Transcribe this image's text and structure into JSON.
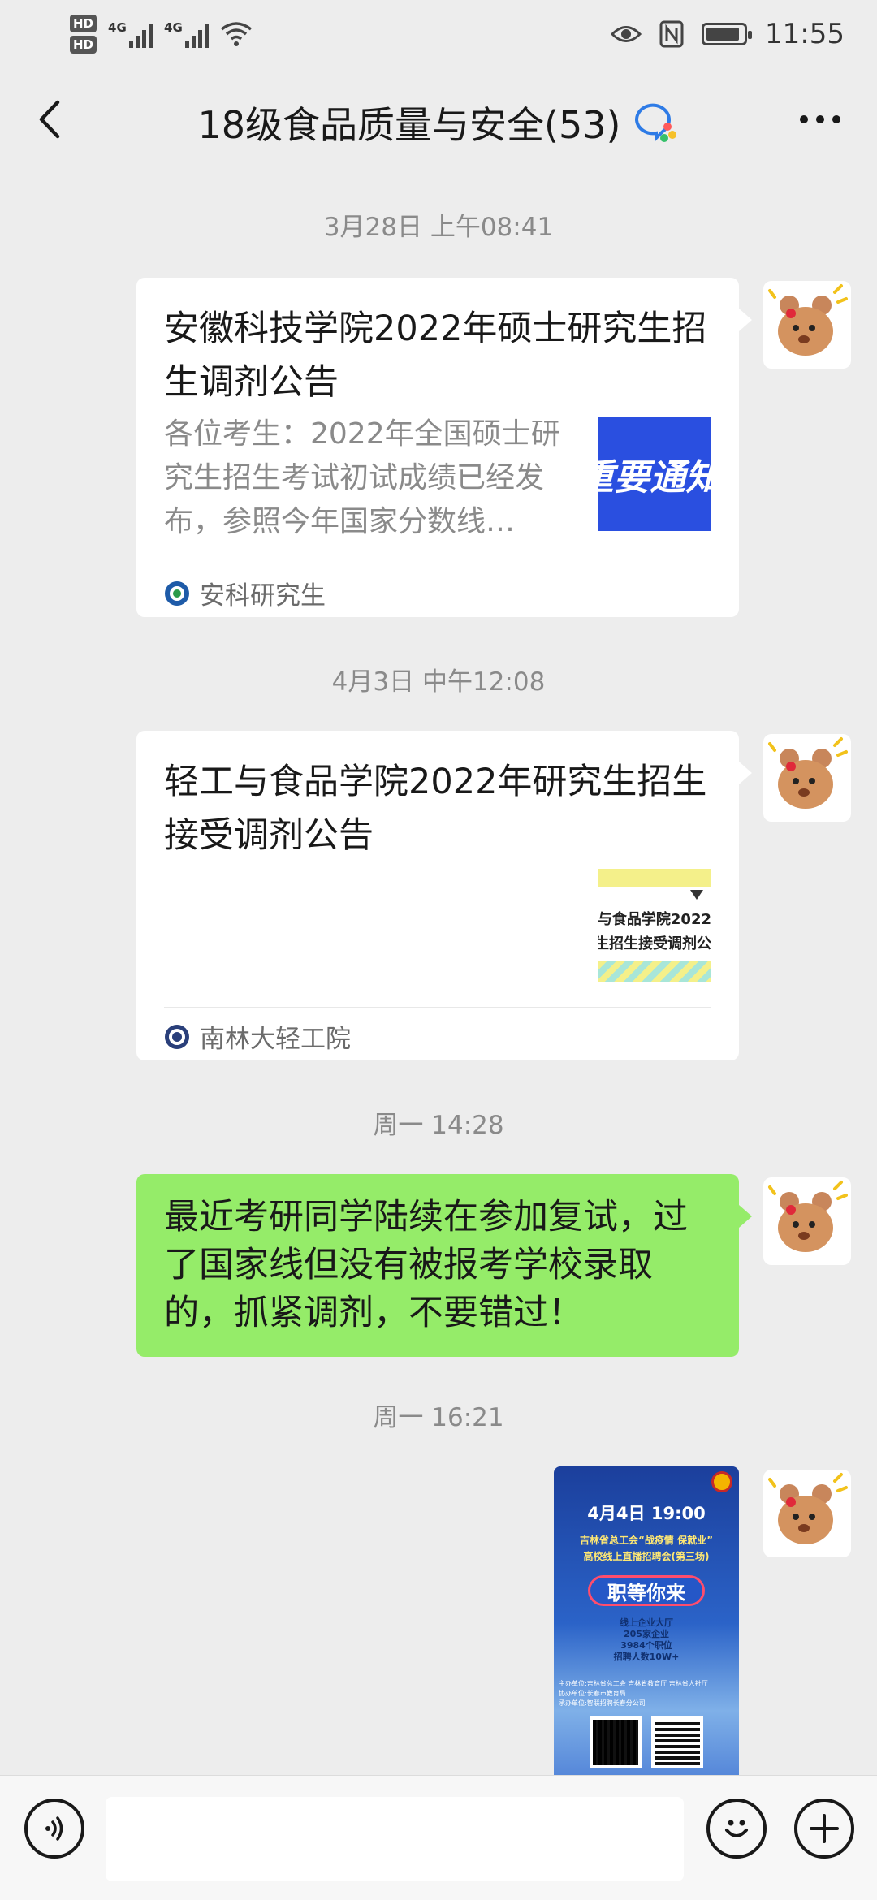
{
  "status_bar": {
    "hd1": "HD",
    "hd2": "HD",
    "sig1_label": "4G",
    "sig2_label": "4G",
    "time": "11:55",
    "battery_level": 0.9
  },
  "nav": {
    "title": "18级食品质量与安全(53)"
  },
  "messages": [
    {
      "timestamp": "3月28日 上午08:41",
      "title": "安徽科技学院2022年硕士研究生招生调剂公告",
      "desc": "各位考生：2022年全国硕士研究生招生考试初试成绩已经发布，参照今年国家分数线…",
      "thumb_text": "重要通知",
      "source": "安科研究生"
    },
    {
      "timestamp": "4月3日 中午12:08",
      "title": "轻工与食品学院2022年研究生招生接受调剂公告",
      "thumb_line1": "与食品学院2022",
      "thumb_line2": "生招生接受调剂公",
      "source": "南林大轻工院"
    },
    {
      "timestamp": "周一 14:28",
      "text": "最近考研同学陆续在参加复试，过了国家线但没有被报考学校录取的，抓紧调剂，不要错过！"
    },
    {
      "timestamp": "周一 16:21",
      "poster": {
        "date": "4月4日 19:00",
        "line1": "吉林省总工会“战疫情 保就业”",
        "line2": "高校线上直播招聘会(第三场)",
        "headline": "职等你来",
        "stat1": "线上企业大厅",
        "stat2": "205家企业",
        "stat3": "3984个职位",
        "stat4": "招聘人数10W+",
        "org1": "主办单位:吉林省总工会 吉林省教育厅 吉林省人社厅",
        "org2": "协办单位:长春市教育局",
        "org3": "承办单位:智联招聘长春分公司"
      }
    }
  ],
  "input": {
    "placeholder": ""
  },
  "colors": {
    "bubble_green": "#95ec69",
    "background": "#ededed"
  },
  "icons": [
    "back-arrow-icon",
    "more-icon",
    "voice-icon",
    "emoji-icon",
    "plus-icon",
    "group-chat-icon"
  ]
}
